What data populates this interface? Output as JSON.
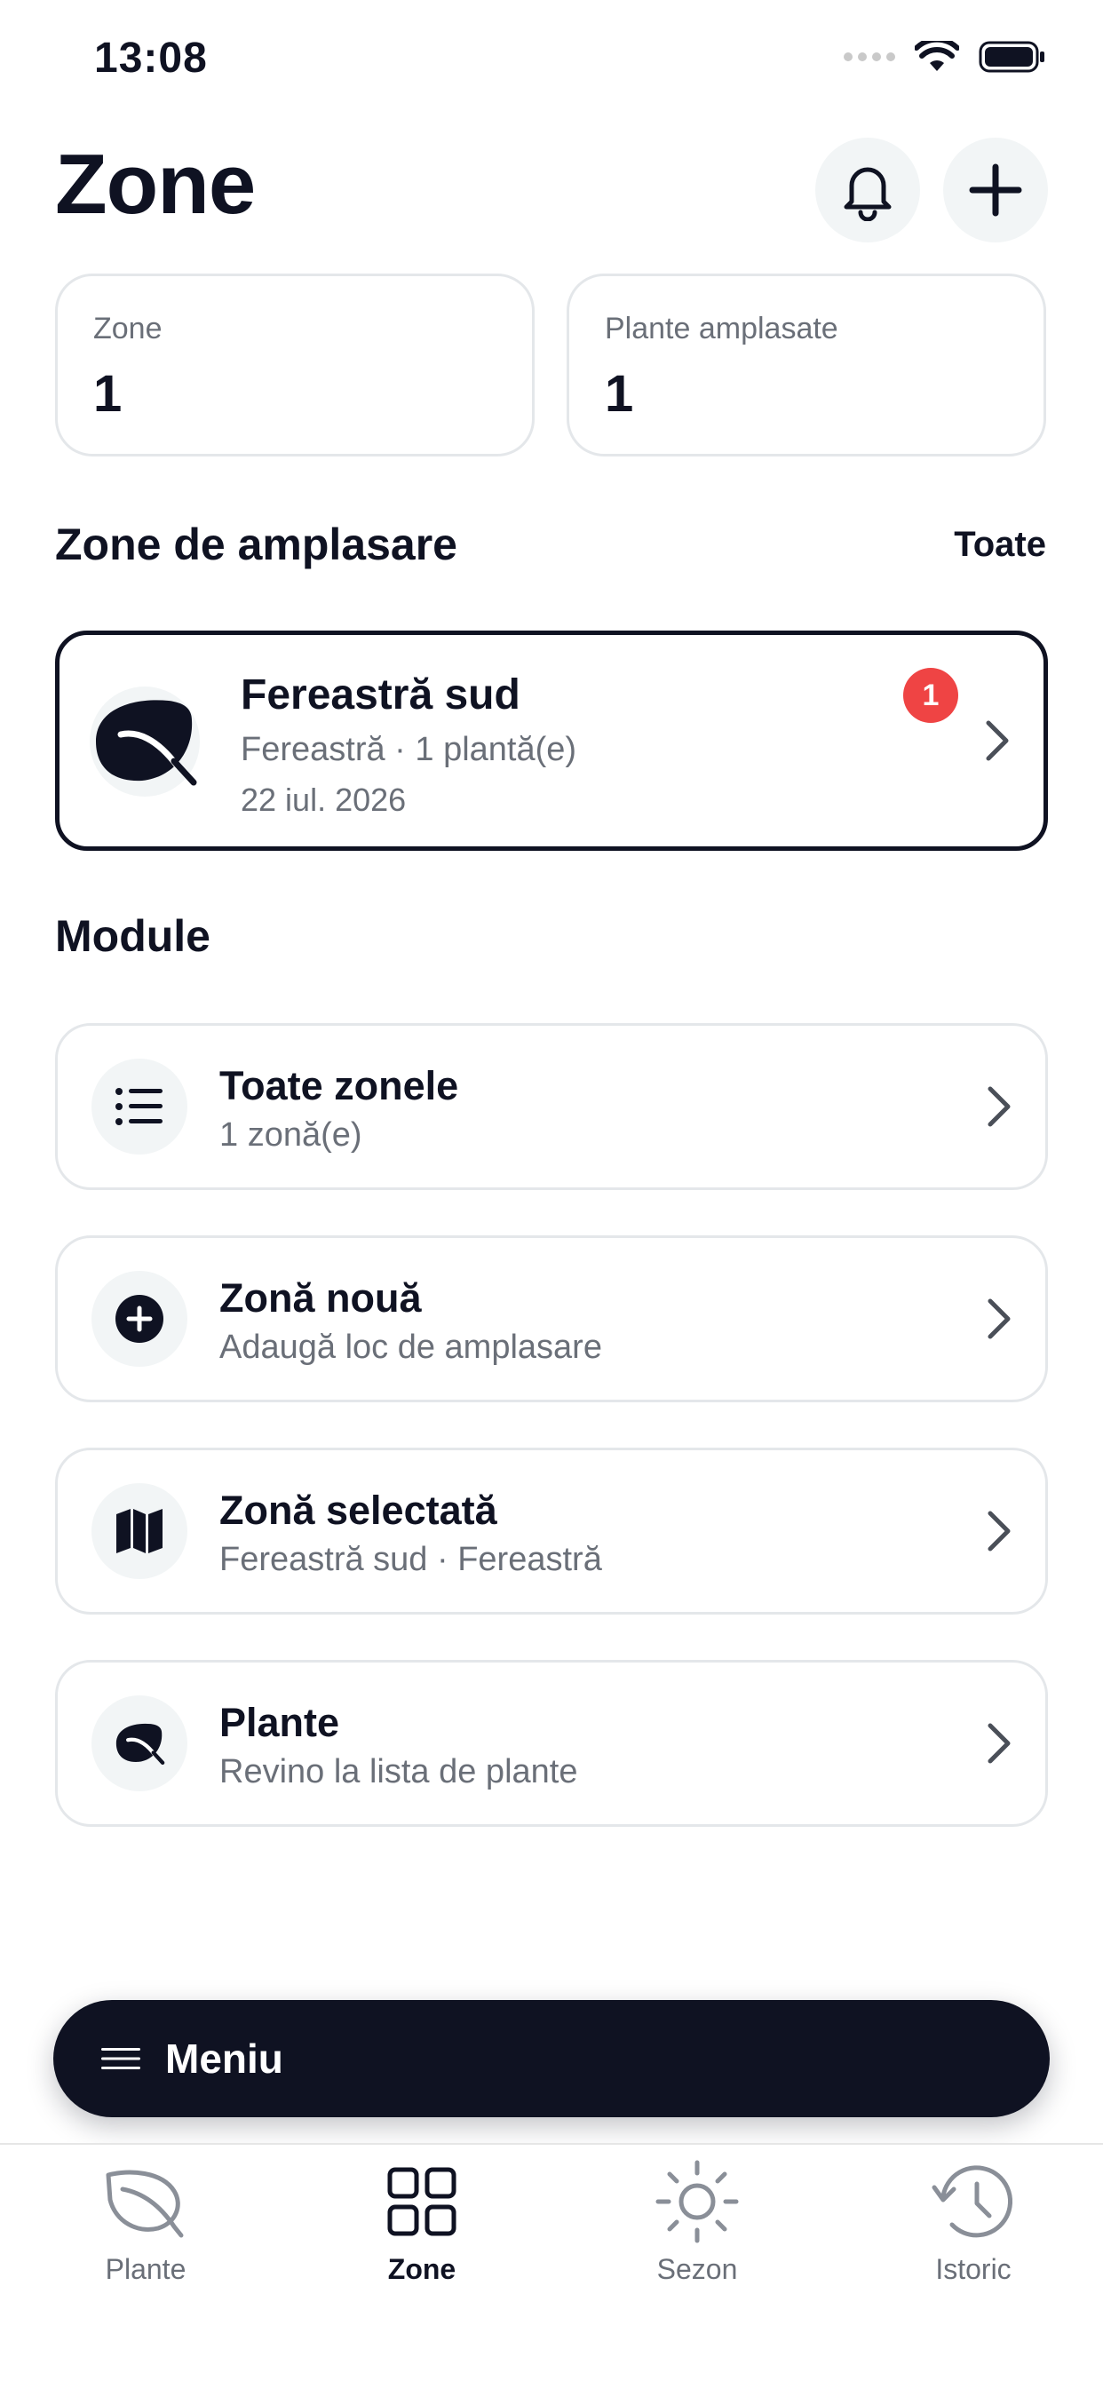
{
  "status": {
    "time": "13:08"
  },
  "header": {
    "title": "Zone"
  },
  "stats": [
    {
      "label": "Zone",
      "value": "1"
    },
    {
      "label": "Plante amplasate",
      "value": "1"
    }
  ],
  "zones_section": {
    "title": "Zone de amplasare",
    "link": "Toate",
    "zone": {
      "name": "Fereastră sud",
      "meta": "Fereastră · 1 plantă(e)",
      "date": "22 iul. 2026",
      "badge": "1"
    }
  },
  "modules_section": {
    "title": "Module",
    "items": [
      {
        "title": "Toate zonele",
        "subtitle": "1 zonă(e)",
        "icon": "list-icon"
      },
      {
        "title": "Zonă nouă",
        "subtitle": "Adaugă loc de amplasare",
        "icon": "plus-circle-icon"
      },
      {
        "title": "Zonă selectată",
        "subtitle": "Fereastră sud · Fereastră",
        "icon": "map-icon"
      },
      {
        "title": "Plante",
        "subtitle": "Revino la lista de plante",
        "icon": "leaf-icon"
      }
    ]
  },
  "menu": {
    "label": "Meniu"
  },
  "tabs": [
    {
      "label": "Plante",
      "icon": "leaf-icon",
      "active": false
    },
    {
      "label": "Zone",
      "icon": "grid-icon",
      "active": true
    },
    {
      "label": "Sezon",
      "icon": "sun-icon",
      "active": false
    },
    {
      "label": "Istoric",
      "icon": "history-icon",
      "active": false
    }
  ],
  "colors": {
    "primary": "#0f1222",
    "badge": "#ef4444",
    "muted": "#6a6f78",
    "border": "#e4e7ea",
    "icon_bg": "#f2f5f6"
  }
}
